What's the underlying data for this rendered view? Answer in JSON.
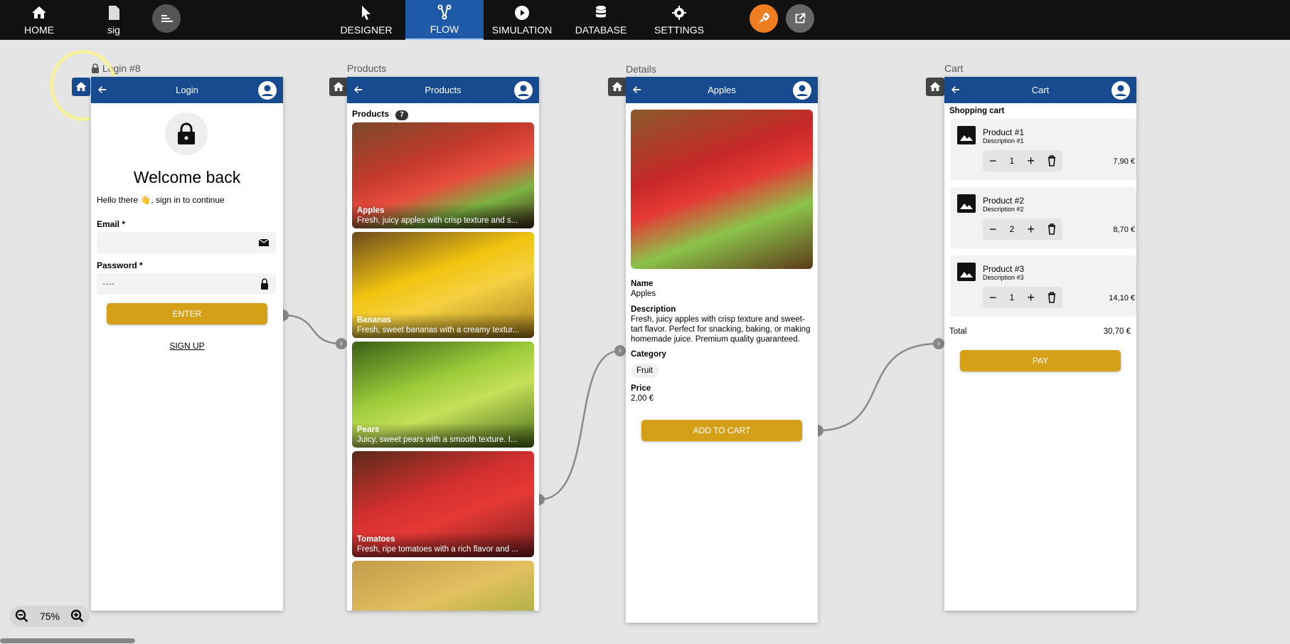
{
  "topbar": {
    "left": [
      {
        "label": "HOME",
        "icon": "home-icon"
      },
      {
        "label": "sig",
        "icon": "document-icon"
      }
    ],
    "tabs": [
      {
        "label": "DESIGNER",
        "icon": "cursor-icon",
        "active": false
      },
      {
        "label": "FLOW",
        "icon": "flow-icon",
        "active": true
      },
      {
        "label": "SIMULATION",
        "icon": "play-icon",
        "active": false
      },
      {
        "label": "DATABASE",
        "icon": "database-icon",
        "active": false
      },
      {
        "label": "SETTINGS",
        "icon": "gear-icon",
        "active": false
      }
    ],
    "accent_color": "#ef7d22"
  },
  "screens": {
    "login": {
      "caption": "Login #8",
      "title": "Login",
      "welcome": "Welcome back",
      "subtitle": "Hello there 👋, sign in to continue",
      "email_label": "Email *",
      "email_value": "",
      "password_label": "Password *",
      "password_value": "····",
      "enter_label": "ENTER",
      "signup_label": "SIGN UP"
    },
    "products": {
      "caption": "Products",
      "title": "Products",
      "list_label": "Products",
      "count": "7",
      "items": [
        {
          "name": "Apples",
          "desc": "Fresh, juicy apples with crisp texture and s..."
        },
        {
          "name": "Bananas",
          "desc": "Fresh, sweet bananas with a creamy textur..."
        },
        {
          "name": "Pears",
          "desc": "Juicy, sweet pears with a smooth texture. I..."
        },
        {
          "name": "Tomatoes",
          "desc": "Fresh, ripe tomatoes with a rich flavor and ..."
        }
      ]
    },
    "details": {
      "caption": "Details",
      "title": "Apples",
      "name_label": "Name",
      "name_value": "Apples",
      "desc_label": "Description",
      "desc_value": "Fresh, juicy apples with crisp texture and sweet-tart flavor. Perfect for snacking, baking, or making homemade juice. Premium quality guaranteed.",
      "category_label": "Category",
      "category_value": "Fruit",
      "price_label": "Price",
      "price_value": "2,00 €",
      "add_label": "ADD TO CART"
    },
    "cart": {
      "caption": "Cart",
      "title": "Cart",
      "heading": "Shopping cart",
      "items": [
        {
          "name": "Product #1",
          "desc": "Description #1",
          "qty": "1",
          "price": "7,90 €"
        },
        {
          "name": "Product #2",
          "desc": "Description #2",
          "qty": "2",
          "price": "8,70 €"
        },
        {
          "name": "Product #3",
          "desc": "Description #3",
          "qty": "1",
          "price": "14,10 €"
        }
      ],
      "total_label": "Total",
      "total_value": "30,70 €",
      "pay_label": "PAY"
    }
  },
  "zoom": {
    "value": "75%"
  }
}
